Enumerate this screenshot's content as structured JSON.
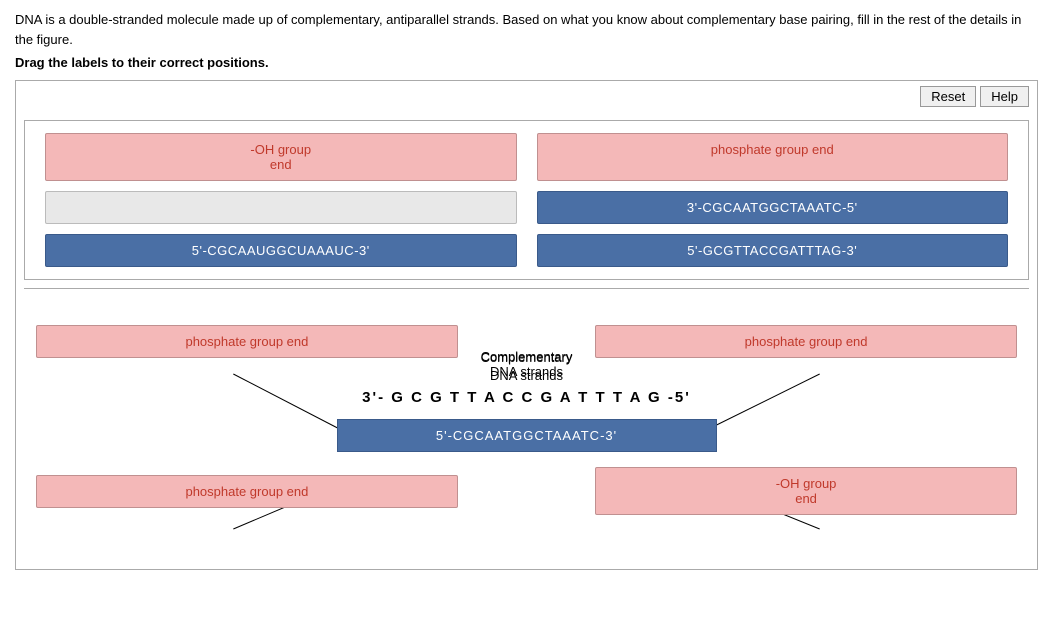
{
  "instruction": "DNA is a double-stranded molecule made up of complementary, antiparallel strands. Based on what you know about complementary base pairing, fill in the rest of the details in the figure.",
  "drag_instruction": "Drag the labels to their correct positions.",
  "buttons": {
    "reset": "Reset",
    "help": "Help"
  },
  "top_section": {
    "left_col": [
      {
        "text": "-OH group\nend",
        "type": "pink",
        "id": "top-left-1"
      },
      {
        "text": "",
        "type": "empty",
        "id": "top-left-2"
      },
      {
        "text": "5'-CGCAAUGGCUAAAUC-3'",
        "type": "blue",
        "id": "top-left-3"
      }
    ],
    "right_col": [
      {
        "text": "phosphate group end",
        "type": "pink",
        "id": "top-right-1"
      },
      {
        "text": "3'-CGCAATGGCTAAATC-5'",
        "type": "blue",
        "id": "top-right-2"
      },
      {
        "text": "5'-GCGTTACCGATTTAG-3'",
        "type": "blue",
        "id": "top-right-3"
      }
    ]
  },
  "bottom_section": {
    "complementary_label": "Complementary\nDNA strands",
    "left_label": {
      "text": "phosphate group end",
      "type": "pink"
    },
    "right_label": {
      "text": "phosphate group end",
      "type": "pink"
    },
    "strand1": "3'- G C G T T A C C G A T T T A G -5'",
    "strand2": "5'-CGCAATGGCTAAATC-3'",
    "bottom_left_label": {
      "text": "phosphate group end",
      "type": "pink"
    },
    "bottom_right_label": {
      "text": "-OH group\nend",
      "type": "pink"
    }
  }
}
